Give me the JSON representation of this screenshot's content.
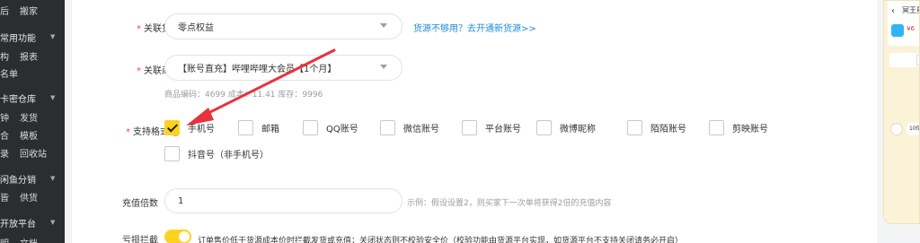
{
  "sidebar": {
    "rows": [
      {
        "a": "后",
        "b": "搬家",
        "group": false
      },
      {
        "a": "常用功能",
        "b": "",
        "group": true
      },
      {
        "a": "构",
        "b": "报表",
        "group": false
      },
      {
        "a": "名单",
        "b": "",
        "group": false
      },
      {
        "a": "卡密仓库",
        "b": "",
        "group": true
      },
      {
        "a": "钟",
        "b": "发货",
        "group": false
      },
      {
        "a": "合",
        "b": "模板",
        "group": false
      },
      {
        "a": "录",
        "b": "回收站",
        "group": false
      },
      {
        "a": "闲鱼分销",
        "b": "",
        "group": true
      },
      {
        "a": "皆",
        "b": "供货",
        "group": false
      },
      {
        "a": "开放平台",
        "b": "",
        "group": true
      },
      {
        "a": "明",
        "b": "文档",
        "group": false
      }
    ]
  },
  "form": {
    "source": {
      "label": "关联货源",
      "value": "零点权益",
      "link": "货源不够用？去开通新货源>>"
    },
    "product": {
      "label": "关联商品",
      "value": "【账号直充】哔哩哔哩大会员【1个月】",
      "meta": "商品编码：4699    成本：11.41    库存：9996"
    },
    "formats": {
      "label": "支持格式",
      "info_icon": "info-icon",
      "options": [
        {
          "label": "手机号",
          "checked": true
        },
        {
          "label": "邮箱",
          "checked": false
        },
        {
          "label": "QQ账号",
          "checked": false
        },
        {
          "label": "微信账号",
          "checked": false
        },
        {
          "label": "平台账号",
          "checked": false
        },
        {
          "label": "微博昵称",
          "checked": false
        },
        {
          "label": "陌陌账号",
          "checked": false
        },
        {
          "label": "剪映账号",
          "checked": false
        },
        {
          "label": "抖音号（非手机号）",
          "checked": false
        }
      ]
    },
    "multiplier": {
      "label": "充值倍数",
      "value": "1",
      "hint": "示例：假设设置2，则买家下一次单将获得2倍的充值内容"
    },
    "loss_block": {
      "label": "亏损拦截",
      "enabled": true,
      "description": "订单售价低于货源成本价时拦截发货或充值；关闭状态则不校验安全价（校验功能由货源平台实现，如货源平台不支持关闭请务必开启）"
    }
  },
  "preview": {
    "title": "冥王星",
    "price": "¥6",
    "bubble": "10倍"
  },
  "colors": {
    "accent": "#ffd21f",
    "link": "#1d8ce0",
    "annotation_arrow": "#e8323c"
  }
}
